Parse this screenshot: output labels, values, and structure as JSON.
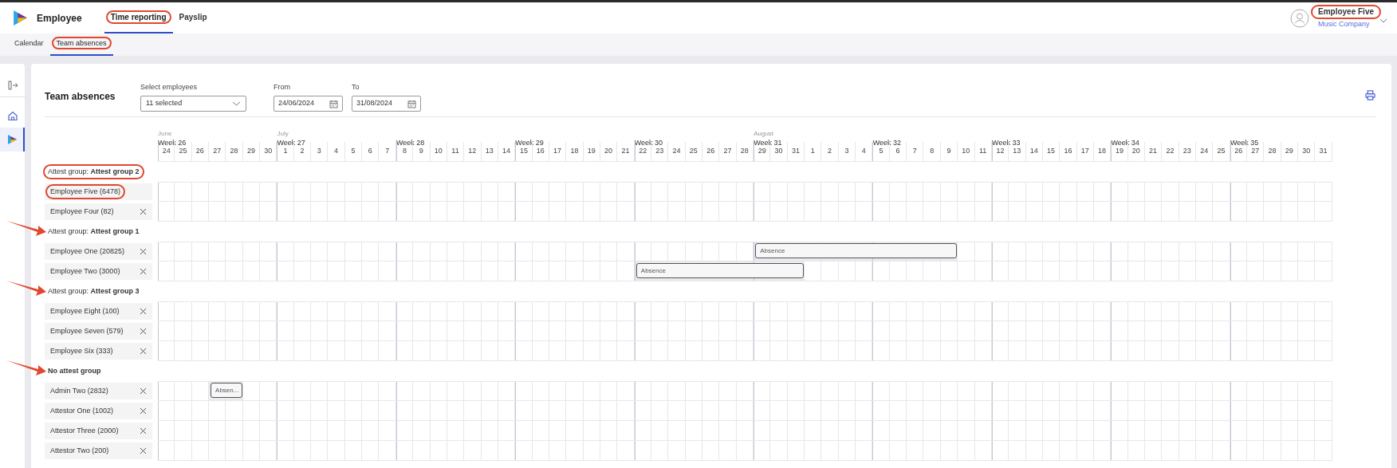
{
  "app": {
    "title": "Employee"
  },
  "tabs": [
    {
      "label": "Time reporting",
      "selected": true,
      "highlighted": true
    },
    {
      "label": "Payslip",
      "selected": false
    }
  ],
  "subtabs": [
    {
      "label": "Calendar",
      "selected": false
    },
    {
      "label": "Team absences",
      "selected": true,
      "highlighted": true
    }
  ],
  "user": {
    "name": "Employee Five",
    "company": "Music Company",
    "highlighted": true
  },
  "sidebar": {
    "items": [
      {
        "kind": "logout",
        "selected": false
      },
      {
        "kind": "home",
        "selected": false
      },
      {
        "kind": "app",
        "selected": true
      }
    ]
  },
  "page": {
    "title": "Team absences",
    "employees_select": {
      "label": "Select employees",
      "value": "11 selected"
    },
    "from": {
      "label": "From",
      "value": "24/06/2024"
    },
    "to": {
      "label": "To",
      "value": "31/08/2024"
    }
  },
  "calendar": {
    "weeks": [
      {
        "month": "June",
        "label": "Week 26",
        "days": [
          "24",
          "25",
          "26",
          "27",
          "28",
          "29",
          "30"
        ]
      },
      {
        "month": "July",
        "label": "Week 27",
        "days": [
          "1",
          "2",
          "3",
          "4",
          "5",
          "6",
          "7"
        ]
      },
      {
        "label": "Week 28",
        "days": [
          "8",
          "9",
          "10",
          "11",
          "12",
          "13",
          "14"
        ]
      },
      {
        "label": "Week 29",
        "days": [
          "15",
          "16",
          "17",
          "18",
          "19",
          "20",
          "21"
        ]
      },
      {
        "label": "Week 30",
        "days": [
          "22",
          "23",
          "24",
          "25",
          "26",
          "27",
          "28"
        ]
      },
      {
        "month": "August",
        "label": "Week 31",
        "days": [
          "29",
          "30",
          "31",
          "1",
          "2",
          "3",
          "4"
        ]
      },
      {
        "label": "Week 32",
        "days": [
          "5",
          "6",
          "7",
          "8",
          "9",
          "10",
          "11"
        ]
      },
      {
        "label": "Week 33",
        "days": [
          "12",
          "13",
          "14",
          "15",
          "16",
          "17",
          "18"
        ]
      },
      {
        "label": "Week 34",
        "days": [
          "19",
          "20",
          "21",
          "22",
          "23",
          "24",
          "25"
        ]
      },
      {
        "label": "Week 35",
        "days": [
          "26",
          "27",
          "28",
          "29",
          "30",
          "31"
        ]
      }
    ],
    "groups": [
      {
        "kind": "attest",
        "label": "Attest group: **Attest group 2**",
        "highlighted": true,
        "employees": [
          {
            "name": "Employee Five (6478)",
            "removable": false,
            "highlighted": true
          },
          {
            "name": "Employee Four (82)",
            "removable": true
          }
        ]
      },
      {
        "kind": "attest",
        "label": "Attest group: **Attest group 1**",
        "arrow": true,
        "employees": [
          {
            "name": "Employee One (20825)",
            "removable": true,
            "absences": [
              {
                "label": "Absence"
              }
            ],
            "absent": [
              false,
              false,
              false,
              false,
              false,
              false,
              false,
              false,
              false,
              false,
              false,
              false,
              false,
              false,
              false,
              false,
              false,
              false,
              false,
              false,
              false,
              false,
              false,
              false,
              false,
              false,
              false,
              false,
              false,
              false,
              false,
              false,
              false,
              false,
              false,
              true,
              true,
              true,
              true,
              true,
              true,
              true,
              true,
              true,
              true,
              true,
              true,
              false,
              false,
              false,
              false,
              false,
              false,
              false,
              false,
              false,
              false,
              false,
              false,
              false,
              false,
              false,
              false,
              false,
              false,
              false,
              false,
              false,
              false
            ]
          },
          {
            "name": "Employee Two (3000)",
            "removable": true,
            "absences": [
              {
                "label": "Absence"
              }
            ],
            "absent": [
              false,
              false,
              false,
              false,
              false,
              false,
              false,
              false,
              false,
              false,
              false,
              false,
              false,
              false,
              false,
              false,
              false,
              false,
              false,
              false,
              false,
              false,
              false,
              false,
              false,
              false,
              false,
              false,
              true,
              true,
              true,
              true,
              true,
              true,
              true,
              true,
              true,
              true,
              false,
              false,
              false,
              false,
              false,
              false,
              false,
              false,
              false,
              false,
              false,
              false,
              false,
              false,
              false,
              false,
              false,
              false,
              false,
              false,
              false,
              false,
              false,
              false,
              false,
              false,
              false,
              false,
              false,
              false,
              false
            ]
          }
        ]
      },
      {
        "kind": "attest",
        "label": "Attest group: **Attest group 3**",
        "arrow": true,
        "employees": [
          {
            "name": "Employee Eight (100)",
            "removable": true
          },
          {
            "name": "Employee Seven (579)",
            "removable": true
          },
          {
            "name": "Employee Six (333)",
            "removable": true
          }
        ]
      },
      {
        "kind": "none",
        "label": "No attest group",
        "arrow": true,
        "employees": [
          {
            "name": "Admin Two (2832)",
            "removable": true,
            "absences": [
              {
                "label": "Absen..."
              }
            ],
            "absent": [
              false,
              false,
              false,
              true,
              true,
              false,
              false,
              false,
              false,
              false,
              false,
              false,
              false,
              false,
              false,
              false,
              false,
              false,
              false,
              false,
              false,
              false,
              false,
              false,
              false,
              false,
              false,
              false,
              false,
              false,
              false,
              false,
              false,
              false,
              false,
              false,
              false,
              false,
              false,
              false,
              false,
              false,
              false,
              false,
              false,
              false,
              false,
              false,
              false,
              false,
              false,
              false,
              false,
              false,
              false,
              false,
              false,
              false,
              false,
              false,
              false,
              false,
              false,
              false,
              false,
              false,
              false,
              false,
              false
            ]
          },
          {
            "name": "Attestor One (1002)",
            "removable": true
          },
          {
            "name": "Attestor Three (2000)",
            "removable": true
          },
          {
            "name": "Attestor Two (200)",
            "removable": true
          }
        ]
      }
    ]
  }
}
